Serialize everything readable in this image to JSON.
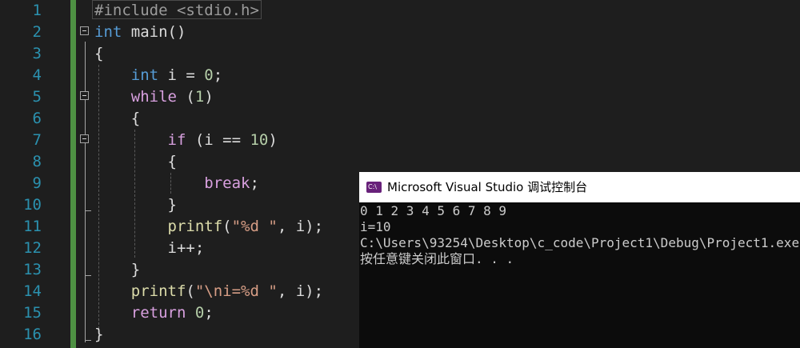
{
  "editor": {
    "line_numbers": [
      "1",
      "2",
      "3",
      "4",
      "5",
      "6",
      "7",
      "8",
      "9",
      "10",
      "11",
      "12",
      "13",
      "14",
      "15",
      "16"
    ],
    "lines": [
      [
        {
          "t": "#include <stdio.h>",
          "c": "pp"
        }
      ],
      [
        {
          "t": "int",
          "c": "kw"
        },
        {
          "t": " main()",
          "c": "id"
        }
      ],
      [
        {
          "t": "{",
          "c": "id"
        }
      ],
      [
        {
          "t": "    ",
          "c": "id"
        },
        {
          "t": "int",
          "c": "kw"
        },
        {
          "t": " i = ",
          "c": "id"
        },
        {
          "t": "0",
          "c": "num"
        },
        {
          "t": ";",
          "c": "id"
        }
      ],
      [
        {
          "t": "    ",
          "c": "id"
        },
        {
          "t": "while",
          "c": "ctl"
        },
        {
          "t": " (",
          "c": "id"
        },
        {
          "t": "1",
          "c": "num"
        },
        {
          "t": ")",
          "c": "id"
        }
      ],
      [
        {
          "t": "    {",
          "c": "id"
        }
      ],
      [
        {
          "t": "        ",
          "c": "id"
        },
        {
          "t": "if",
          "c": "ctl"
        },
        {
          "t": " (i == ",
          "c": "id"
        },
        {
          "t": "10",
          "c": "num"
        },
        {
          "t": ")",
          "c": "id"
        }
      ],
      [
        {
          "t": "        {",
          "c": "id"
        }
      ],
      [
        {
          "t": "            ",
          "c": "id"
        },
        {
          "t": "break",
          "c": "ctl"
        },
        {
          "t": ";",
          "c": "id"
        }
      ],
      [
        {
          "t": "        }",
          "c": "id"
        }
      ],
      [
        {
          "t": "        ",
          "c": "id"
        },
        {
          "t": "printf",
          "c": "fn"
        },
        {
          "t": "(",
          "c": "id"
        },
        {
          "t": "\"%d \"",
          "c": "str"
        },
        {
          "t": ", i);",
          "c": "id"
        }
      ],
      [
        {
          "t": "        i++;",
          "c": "id"
        }
      ],
      [
        {
          "t": "    }",
          "c": "id"
        }
      ],
      [
        {
          "t": "    ",
          "c": "id"
        },
        {
          "t": "printf",
          "c": "fn"
        },
        {
          "t": "(",
          "c": "id"
        },
        {
          "t": "\"\\ni=%d \"",
          "c": "str"
        },
        {
          "t": ", i);",
          "c": "id"
        }
      ],
      [
        {
          "t": "    ",
          "c": "id"
        },
        {
          "t": "return",
          "c": "ctl"
        },
        {
          "t": " ",
          "c": "id"
        },
        {
          "t": "0",
          "c": "num"
        },
        {
          "t": ";",
          "c": "id"
        }
      ],
      [
        {
          "t": "}",
          "c": "id"
        }
      ]
    ]
  },
  "console": {
    "icon_label": "C:\\",
    "title": "Microsoft Visual Studio 调试控制台",
    "output": [
      "0 1 2 3 4 5 6 7 8 9",
      "i=10",
      "C:\\Users\\93254\\Desktop\\c_code\\Project1\\Debug\\Project1.exe",
      "按任意键关闭此窗口. . ."
    ]
  },
  "colors": {
    "editor_bg": "#1e1e1e",
    "line_number": "#2b91af",
    "keyword": "#569cd6",
    "control": "#d8a0df",
    "string": "#d69d85",
    "number": "#b5cea8",
    "function": "#dcdcaa",
    "change_bar": "#57a64a"
  }
}
